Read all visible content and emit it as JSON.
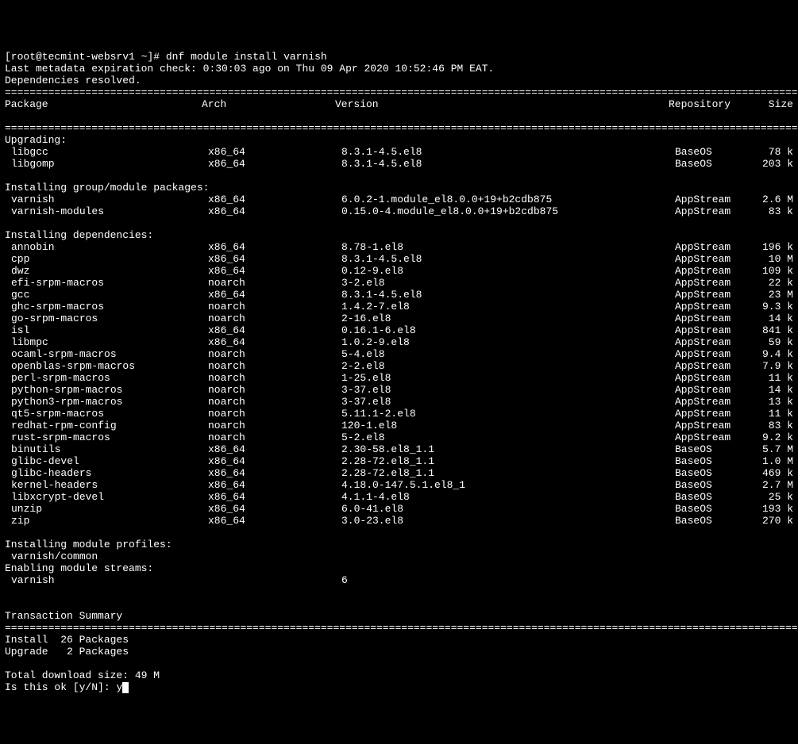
{
  "prompt": {
    "user_host": "[root@tecmint-websrv1 ~]#",
    "command": "dnf module install varnish"
  },
  "metadata_line": "Last metadata expiration check: 0:30:03 ago on Thu 09 Apr 2020 10:52:46 PM EAT.",
  "deps_line": "Dependencies resolved.",
  "rule": "=====================================================================================================================================",
  "headers": {
    "package": "Package",
    "arch": "Arch",
    "version": "Version",
    "repository": "Repository",
    "size": "Size"
  },
  "sections": {
    "upgrading": "Upgrading:",
    "group": "Installing group/module packages:",
    "deps": "Installing dependencies:",
    "profiles": "Installing module profiles:",
    "streams": "Enabling module streams:"
  },
  "upgrading": [
    {
      "pkg": "libgcc",
      "arch": "x86_64",
      "ver": "8.3.1-4.5.el8",
      "repo": "BaseOS",
      "size": "78 k"
    },
    {
      "pkg": "libgomp",
      "arch": "x86_64",
      "ver": "8.3.1-4.5.el8",
      "repo": "BaseOS",
      "size": "203 k"
    }
  ],
  "group_pkgs": [
    {
      "pkg": "varnish",
      "arch": "x86_64",
      "ver": "6.0.2-1.module_el8.0.0+19+b2cdb875",
      "repo": "AppStream",
      "size": "2.6 M"
    },
    {
      "pkg": "varnish-modules",
      "arch": "x86_64",
      "ver": "0.15.0-4.module_el8.0.0+19+b2cdb875",
      "repo": "AppStream",
      "size": "83 k"
    }
  ],
  "deps": [
    {
      "pkg": "annobin",
      "arch": "x86_64",
      "ver": "8.78-1.el8",
      "repo": "AppStream",
      "size": "196 k"
    },
    {
      "pkg": "cpp",
      "arch": "x86_64",
      "ver": "8.3.1-4.5.el8",
      "repo": "AppStream",
      "size": "10 M"
    },
    {
      "pkg": "dwz",
      "arch": "x86_64",
      "ver": "0.12-9.el8",
      "repo": "AppStream",
      "size": "109 k"
    },
    {
      "pkg": "efi-srpm-macros",
      "arch": "noarch",
      "ver": "3-2.el8",
      "repo": "AppStream",
      "size": "22 k"
    },
    {
      "pkg": "gcc",
      "arch": "x86_64",
      "ver": "8.3.1-4.5.el8",
      "repo": "AppStream",
      "size": "23 M"
    },
    {
      "pkg": "ghc-srpm-macros",
      "arch": "noarch",
      "ver": "1.4.2-7.el8",
      "repo": "AppStream",
      "size": "9.3 k"
    },
    {
      "pkg": "go-srpm-macros",
      "arch": "noarch",
      "ver": "2-16.el8",
      "repo": "AppStream",
      "size": "14 k"
    },
    {
      "pkg": "isl",
      "arch": "x86_64",
      "ver": "0.16.1-6.el8",
      "repo": "AppStream",
      "size": "841 k"
    },
    {
      "pkg": "libmpc",
      "arch": "x86_64",
      "ver": "1.0.2-9.el8",
      "repo": "AppStream",
      "size": "59 k"
    },
    {
      "pkg": "ocaml-srpm-macros",
      "arch": "noarch",
      "ver": "5-4.el8",
      "repo": "AppStream",
      "size": "9.4 k"
    },
    {
      "pkg": "openblas-srpm-macros",
      "arch": "noarch",
      "ver": "2-2.el8",
      "repo": "AppStream",
      "size": "7.9 k"
    },
    {
      "pkg": "perl-srpm-macros",
      "arch": "noarch",
      "ver": "1-25.el8",
      "repo": "AppStream",
      "size": "11 k"
    },
    {
      "pkg": "python-srpm-macros",
      "arch": "noarch",
      "ver": "3-37.el8",
      "repo": "AppStream",
      "size": "14 k"
    },
    {
      "pkg": "python3-rpm-macros",
      "arch": "noarch",
      "ver": "3-37.el8",
      "repo": "AppStream",
      "size": "13 k"
    },
    {
      "pkg": "qt5-srpm-macros",
      "arch": "noarch",
      "ver": "5.11.1-2.el8",
      "repo": "AppStream",
      "size": "11 k"
    },
    {
      "pkg": "redhat-rpm-config",
      "arch": "noarch",
      "ver": "120-1.el8",
      "repo": "AppStream",
      "size": "83 k"
    },
    {
      "pkg": "rust-srpm-macros",
      "arch": "noarch",
      "ver": "5-2.el8",
      "repo": "AppStream",
      "size": "9.2 k"
    },
    {
      "pkg": "binutils",
      "arch": "x86_64",
      "ver": "2.30-58.el8_1.1",
      "repo": "BaseOS",
      "size": "5.7 M"
    },
    {
      "pkg": "glibc-devel",
      "arch": "x86_64",
      "ver": "2.28-72.el8_1.1",
      "repo": "BaseOS",
      "size": "1.0 M"
    },
    {
      "pkg": "glibc-headers",
      "arch": "x86_64",
      "ver": "2.28-72.el8_1.1",
      "repo": "BaseOS",
      "size": "469 k"
    },
    {
      "pkg": "kernel-headers",
      "arch": "x86_64",
      "ver": "4.18.0-147.5.1.el8_1",
      "repo": "BaseOS",
      "size": "2.7 M"
    },
    {
      "pkg": "libxcrypt-devel",
      "arch": "x86_64",
      "ver": "4.1.1-4.el8",
      "repo": "BaseOS",
      "size": "25 k"
    },
    {
      "pkg": "unzip",
      "arch": "x86_64",
      "ver": "6.0-41.el8",
      "repo": "BaseOS",
      "size": "193 k"
    },
    {
      "pkg": "zip",
      "arch": "x86_64",
      "ver": "3.0-23.el8",
      "repo": "BaseOS",
      "size": "270 k"
    }
  ],
  "profile_line": "varnish/common",
  "stream_name": "varnish",
  "stream_ver": "6",
  "summary_title": "Transaction Summary",
  "summary": {
    "install": "Install  26 Packages",
    "upgrade": "Upgrade   2 Packages"
  },
  "total_download": "Total download size: 49 M",
  "confirm_prompt": "Is this ok [y/N]: ",
  "confirm_input": "y"
}
